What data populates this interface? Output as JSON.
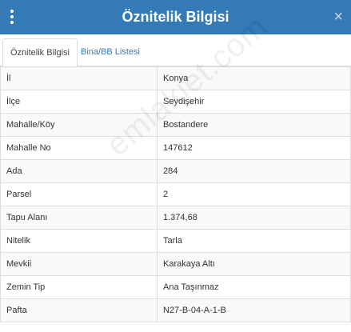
{
  "header": {
    "title": "Öznitelik Bilgisi",
    "close": "×"
  },
  "tabs": [
    {
      "label": "Öznitelik Bilgisi"
    },
    {
      "label": "Bina/BB Listesi"
    }
  ],
  "rows": [
    {
      "key": "İl",
      "value": "Konya"
    },
    {
      "key": "İlçe",
      "value": "Seydişehir"
    },
    {
      "key": "Mahalle/Köy",
      "value": "Bostandere"
    },
    {
      "key": "Mahalle No",
      "value": "147612"
    },
    {
      "key": "Ada",
      "value": "284"
    },
    {
      "key": "Parsel",
      "value": "2"
    },
    {
      "key": "Tapu Alanı",
      "value": "1.374,68"
    },
    {
      "key": "Nitelik",
      "value": "Tarla"
    },
    {
      "key": "Mevkii",
      "value": "Karakaya Altı"
    },
    {
      "key": "Zemin Tip",
      "value": "Ana Taşınmaz"
    },
    {
      "key": "Pafta",
      "value": "N27-B-04-A-1-B"
    }
  ],
  "watermark": "emlakjet.com",
  "colors": {
    "header": "#337ab7",
    "link": "#337ab7"
  }
}
